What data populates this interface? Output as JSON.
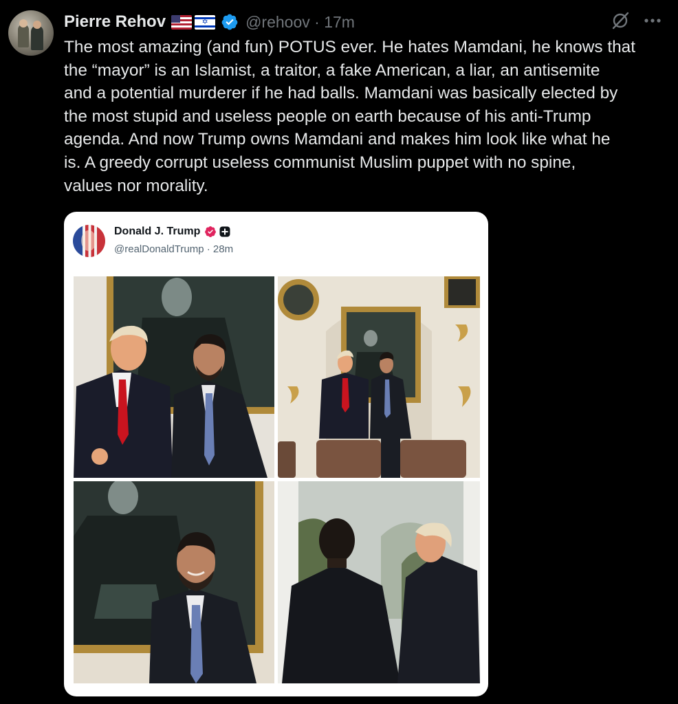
{
  "tweet": {
    "author_name": "Pierre Rehov",
    "flags": [
      "us-flag-icon",
      "israel-flag-icon"
    ],
    "verified": true,
    "handle": "@rehoov",
    "separator": "·",
    "time": "17m",
    "body": "The most amazing (and fun) POTUS ever. He hates Mamdani, he knows that\nthe “mayor” is an Islamist, a traitor, a fake American, a liar, an antisemite\nand a potential murderer if he had balls. Mamdani was basically elected by\nthe most stupid and useless people on earth because of his anti-Trump\nagenda. And now Trump owns Mamdani and makes him look like what he\nis. A greedy corrupt useless communist Muslim puppet with no spine,\nvalues nor morality."
  },
  "actions": {
    "grok_icon": "grok-icon",
    "more_icon": "more-icon"
  },
  "embedded": {
    "author_name": "Donald J. Trump",
    "handle_line": "@realDonaldTrump · 28m",
    "photos": [
      {
        "id": "photo-1",
        "description_icon": "photo"
      },
      {
        "id": "photo-2",
        "description_icon": "photo"
      },
      {
        "id": "photo-3",
        "description_icon": "photo"
      },
      {
        "id": "photo-4",
        "description_icon": "photo"
      }
    ]
  },
  "colors": {
    "background": "#000000",
    "text": "#e7e9ea",
    "muted": "#71767b",
    "verified_blue": "#1d9bf0",
    "card_bg": "#ffffff",
    "truth_badge": "#e0245e"
  }
}
